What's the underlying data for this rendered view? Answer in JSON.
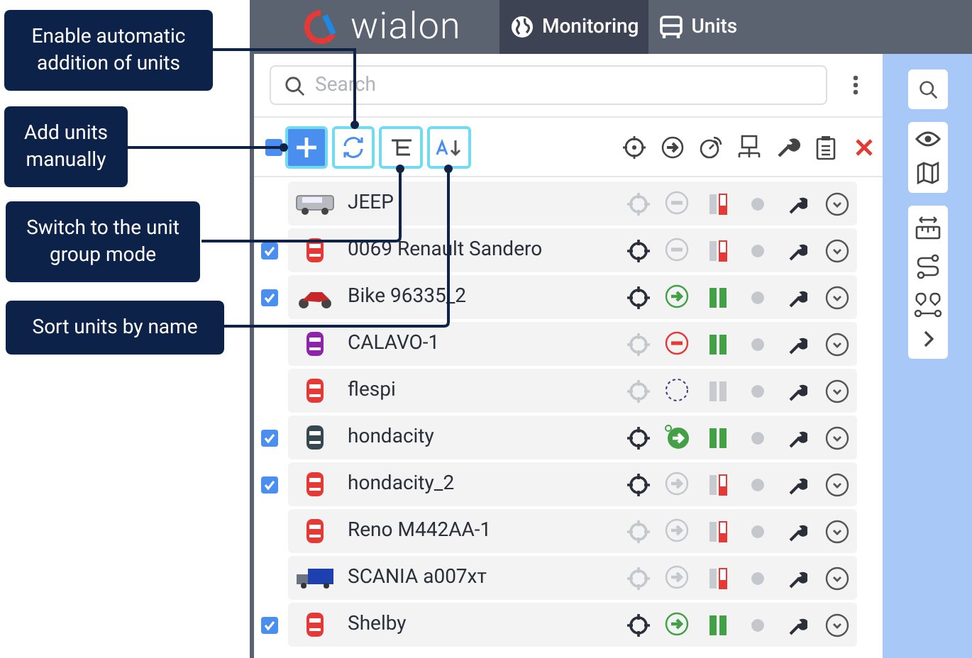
{
  "header": {
    "logo": "wialon",
    "tabs": [
      {
        "label": "Monitoring",
        "selected": true
      },
      {
        "label": "Units",
        "selected": false
      }
    ]
  },
  "search": {
    "placeholder": "Search"
  },
  "toolbar": {
    "select_all_indeterminate": true
  },
  "units": [
    {
      "name": "JEEP",
      "checked": false,
      "vehicle": {
        "kind": "suv",
        "color": "#b8bcc2"
      },
      "located": false,
      "motion": {
        "kind": "stopped"
      },
      "signal": {
        "kind": "weak"
      }
    },
    {
      "name": "0069 Renault Sandero",
      "checked": true,
      "vehicle": {
        "kind": "car",
        "color": "#e53935"
      },
      "located": true,
      "motion": {
        "kind": "stopped"
      },
      "signal": {
        "kind": "weak"
      }
    },
    {
      "name": "Bike 96335_2",
      "checked": true,
      "vehicle": {
        "kind": "motorbike",
        "color": "#c62828"
      },
      "located": true,
      "motion": {
        "kind": "moving"
      },
      "signal": {
        "kind": "good"
      }
    },
    {
      "name": "CALAVO-1",
      "checked": false,
      "vehicle": {
        "kind": "car",
        "color": "#8e24aa"
      },
      "located": false,
      "motion": {
        "kind": "alert"
      },
      "signal": {
        "kind": "good"
      }
    },
    {
      "name": "flespi",
      "checked": false,
      "vehicle": {
        "kind": "car",
        "color": "#e53935"
      },
      "located": false,
      "motion": {
        "kind": "unknown"
      },
      "signal": {
        "kind": "none"
      }
    },
    {
      "name": "hondacity",
      "checked": true,
      "vehicle": {
        "kind": "car",
        "color": "#37474f"
      },
      "located": true,
      "motion": {
        "kind": "trip"
      },
      "signal": {
        "kind": "good"
      }
    },
    {
      "name": "hondacity_2",
      "checked": true,
      "vehicle": {
        "kind": "car",
        "color": "#e53935"
      },
      "located": true,
      "motion": {
        "kind": "idle"
      },
      "signal": {
        "kind": "weak"
      }
    },
    {
      "name": "Reno M442AA-1",
      "checked": false,
      "vehicle": {
        "kind": "car",
        "color": "#e53935"
      },
      "located": false,
      "motion": {
        "kind": "idle"
      },
      "signal": {
        "kind": "weak"
      }
    },
    {
      "name": "SCANIA а007хт",
      "checked": false,
      "vehicle": {
        "kind": "truck",
        "color": "#1e40af"
      },
      "located": false,
      "motion": {
        "kind": "idle"
      },
      "signal": {
        "kind": "weak"
      }
    },
    {
      "name": "Shelby",
      "checked": true,
      "vehicle": {
        "kind": "car",
        "color": "#e53935"
      },
      "located": true,
      "motion": {
        "kind": "moving"
      },
      "signal": {
        "kind": "good"
      }
    }
  ],
  "callouts": [
    {
      "text": "Enable automatic addition of units"
    },
    {
      "text": "Add units manually"
    },
    {
      "text": "Switch to the unit group mode"
    },
    {
      "text": "Sort units by name"
    }
  ]
}
